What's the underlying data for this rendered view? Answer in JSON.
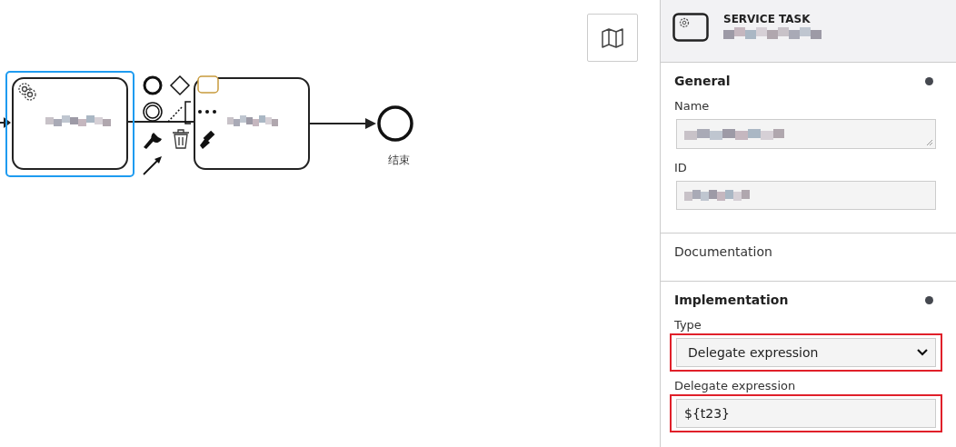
{
  "canvas": {
    "tasks": [
      {
        "kind": "service",
        "selected": true
      },
      {
        "kind": "plain",
        "selected": false
      }
    ],
    "end_event": {
      "label": "结束"
    }
  },
  "panel": {
    "header": {
      "type_label": "SERVICE TASK"
    },
    "groups": [
      {
        "title": "General",
        "has_entries": true,
        "fields": [
          {
            "kind": "textarea",
            "label": "Name",
            "highlighted": false
          },
          {
            "kind": "input",
            "label": "ID",
            "highlighted": false
          }
        ]
      },
      {
        "title": "Documentation",
        "has_entries": false
      },
      {
        "title": "Implementation",
        "has_entries": true,
        "fields": [
          {
            "kind": "select",
            "label": "Type",
            "value": "Delegate expression",
            "highlighted": true
          },
          {
            "kind": "input",
            "label": "Delegate expression",
            "value": "${t23}",
            "highlighted": true
          }
        ]
      }
    ]
  }
}
